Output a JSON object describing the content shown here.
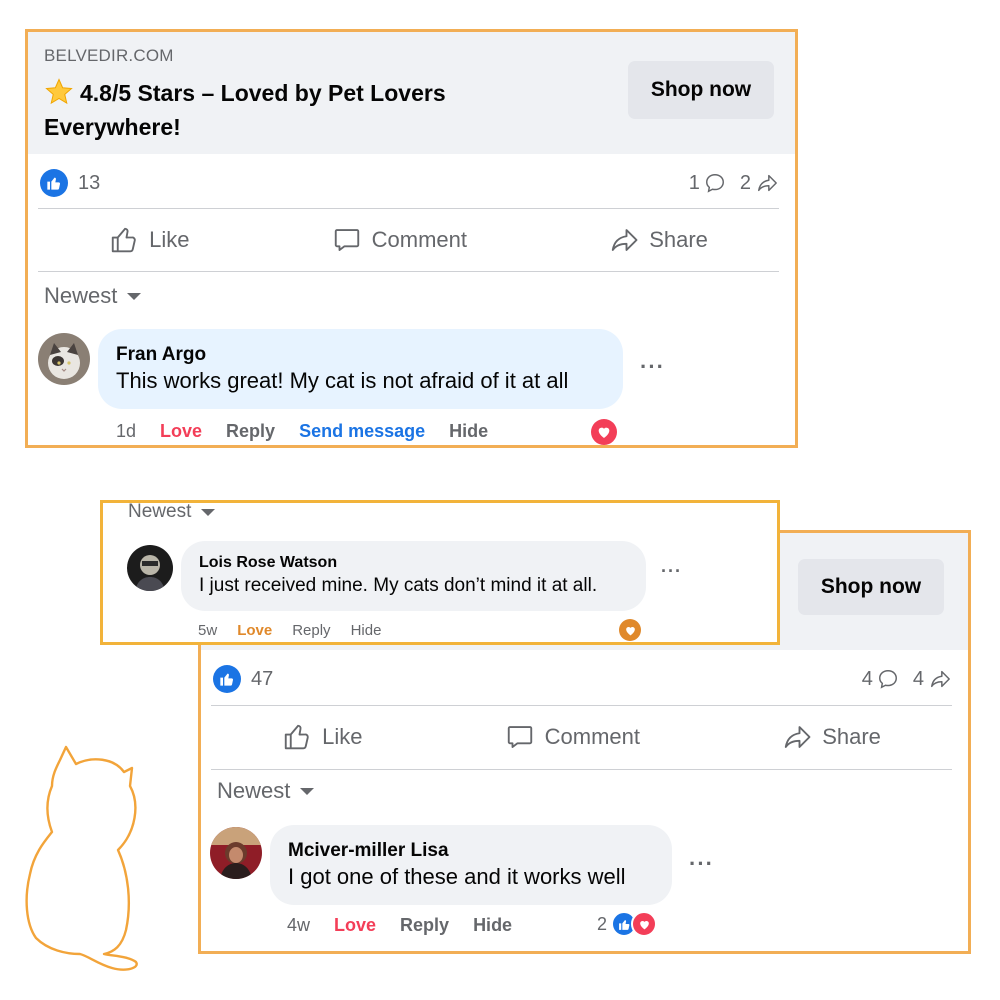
{
  "ad_top": {
    "domain": "BELVEDIR.COM",
    "title": "4.8/5 Stars – Loved by Pet Lovers Everywhere!",
    "icon": "star-icon",
    "shop_button": "Shop now",
    "like_count": "13",
    "comment_count": "1",
    "share_count": "2",
    "actions": {
      "like": "Like",
      "comment": "Comment",
      "share": "Share"
    },
    "sort_label": "Newest",
    "comment": {
      "author": "Fran Argo",
      "text": "This works great! My cat is not afraid of it at all",
      "time": "1d",
      "love": "Love",
      "reply": "Reply",
      "send_message": "Send message",
      "hide": "Hide"
    }
  },
  "overlay_comment": {
    "sort_label": "Newest",
    "author": "Lois Rose Watson",
    "text": "I just received mine. My cats don’t mind it at all.",
    "time": "5w",
    "love": "Love",
    "reply": "Reply",
    "hide": "Hide"
  },
  "ad_bottom": {
    "shop_button": "Shop now",
    "like_count": "47",
    "comment_count": "4",
    "share_count": "4",
    "actions": {
      "like": "Like",
      "comment": "Comment",
      "share": "Share"
    },
    "sort_label": "Newest",
    "comment": {
      "author": "Mciver-miller Lisa",
      "text": "I got one of these and it works well",
      "time": "4w",
      "love": "Love",
      "reply": "Reply",
      "hide": "Hide",
      "reaction_count": "2"
    }
  },
  "colors": {
    "frame": "#f2ae55",
    "facebook_blue": "#1b74e4",
    "love_red": "#f33e58",
    "love_orange": "#e0892b",
    "muted_text": "#65676b"
  }
}
